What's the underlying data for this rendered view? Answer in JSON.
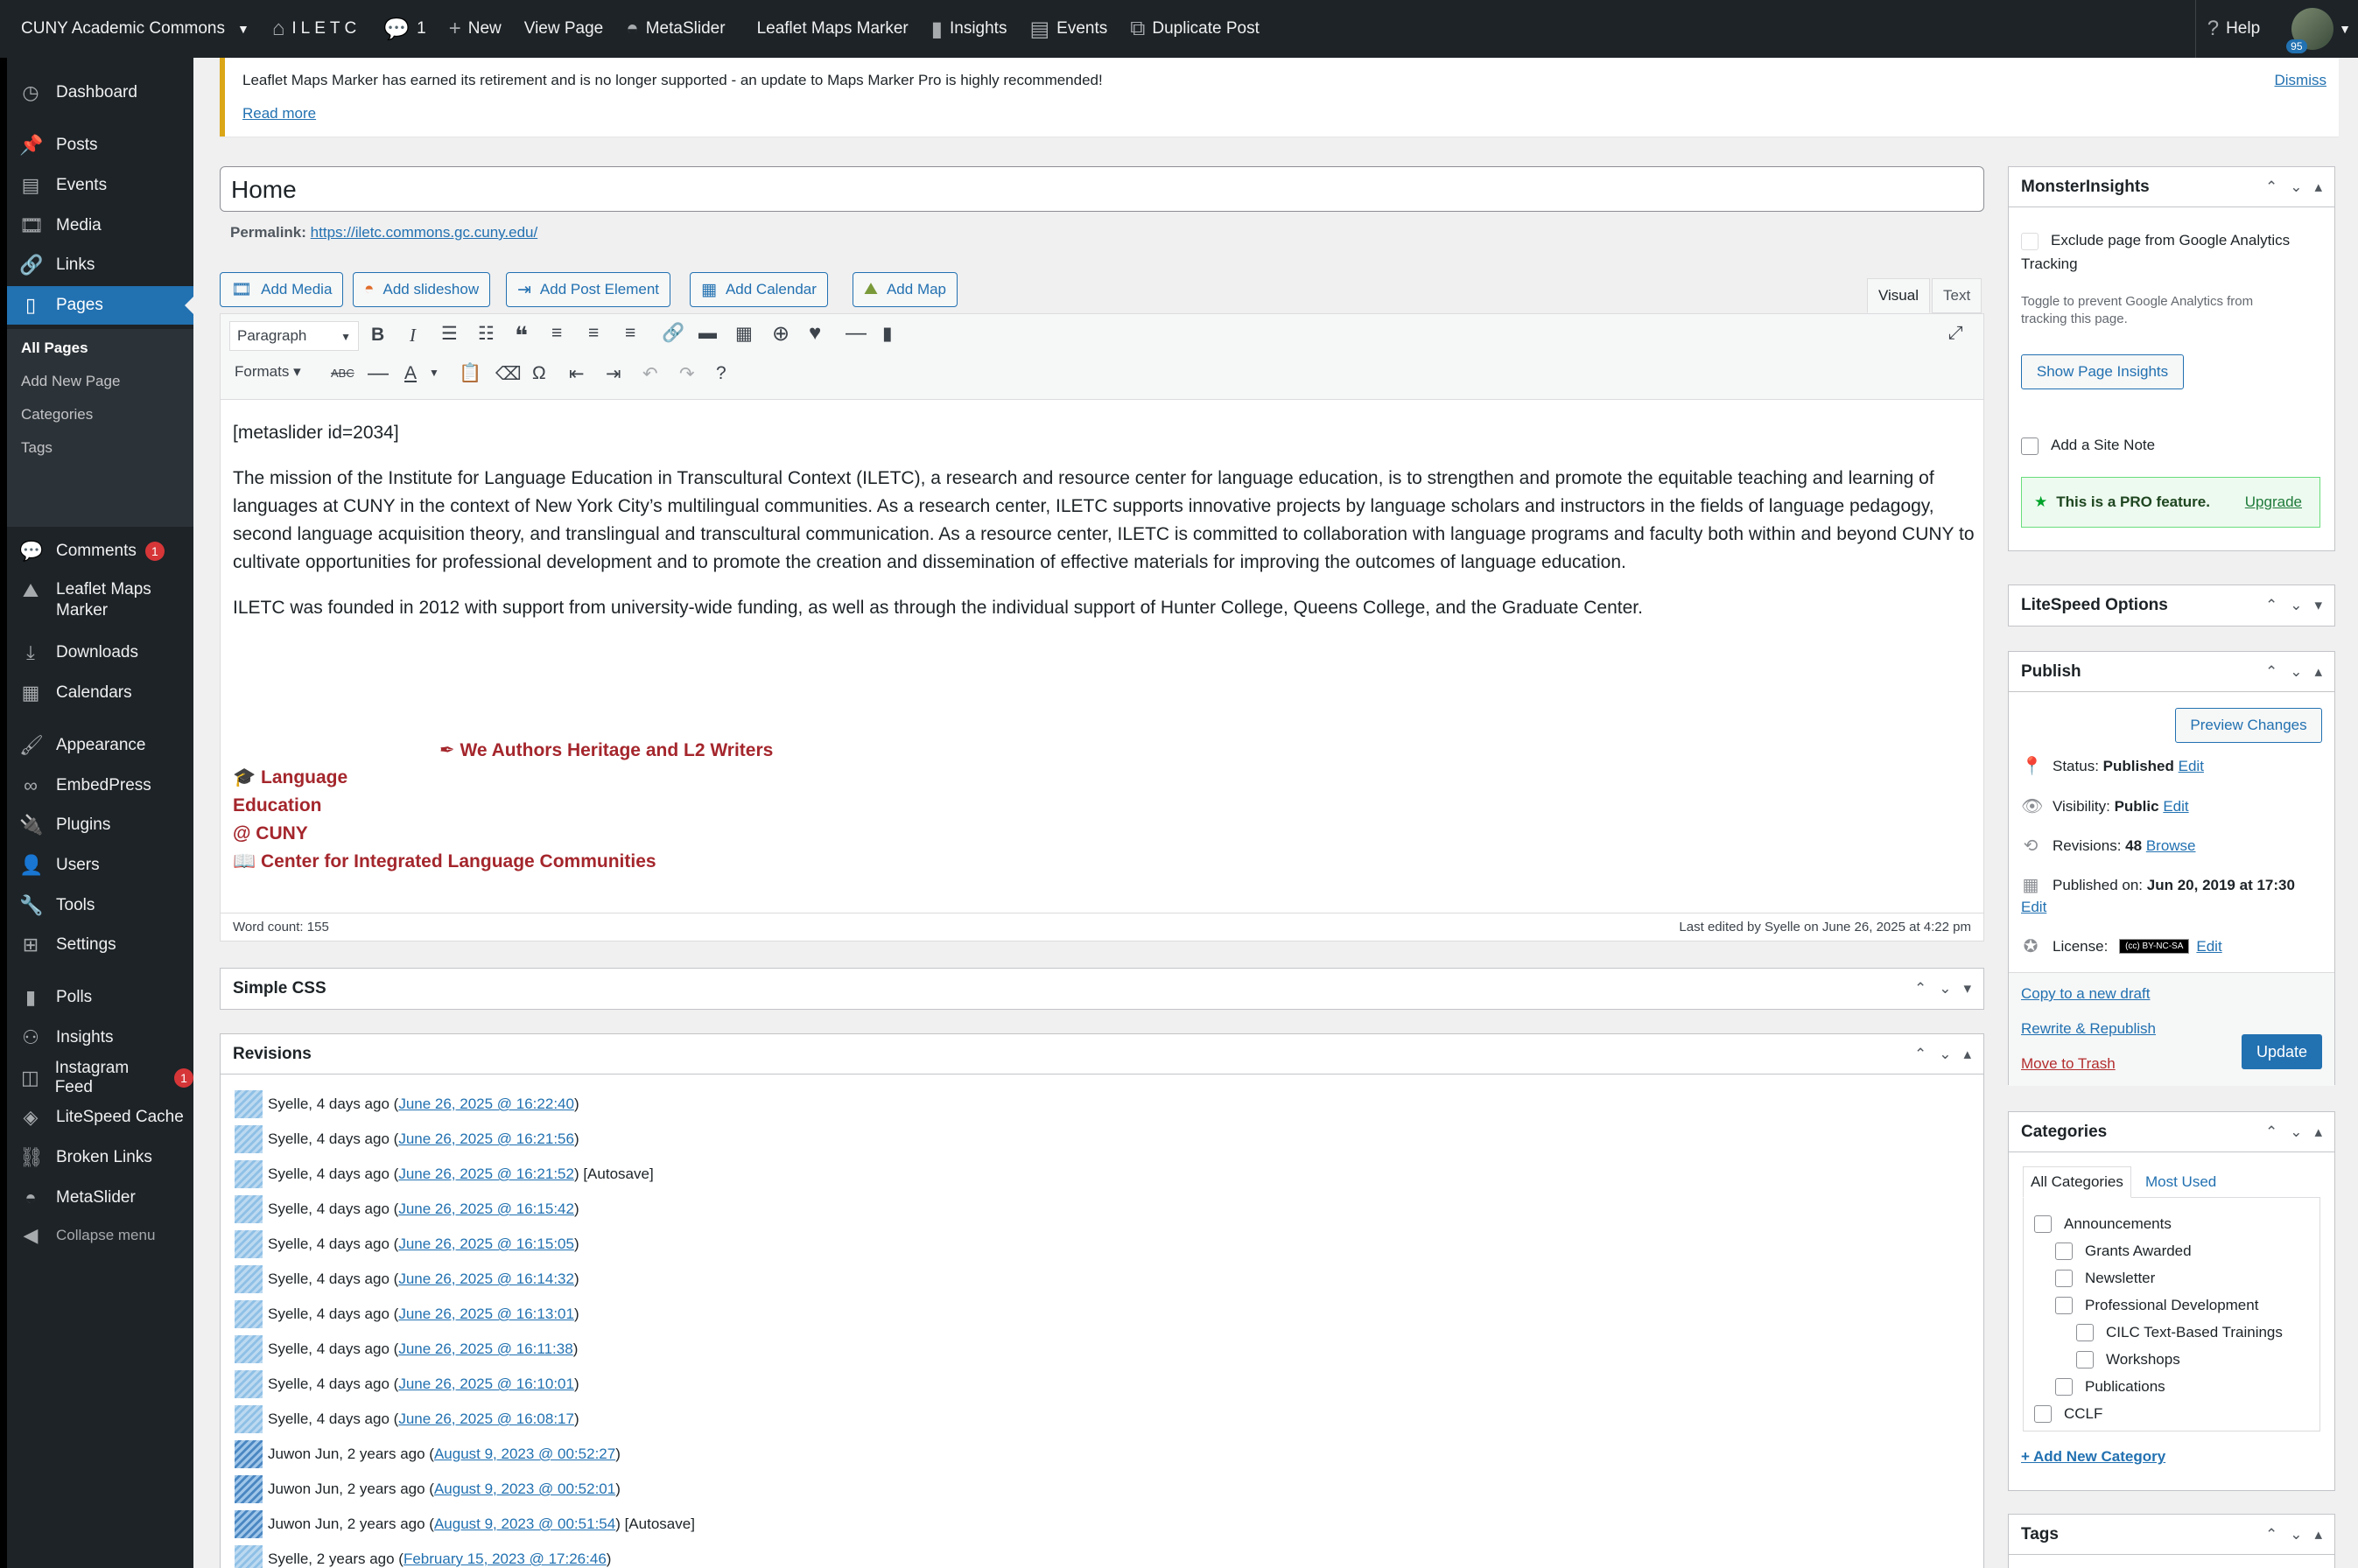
{
  "adminbar": {
    "site_name": "CUNY Academic Commons",
    "site": "ILETC",
    "comments_count": "1",
    "new": "New",
    "view_page": "View Page",
    "metaslider": "MetaSlider",
    "leaflet": "Leaflet Maps Marker",
    "insights": "Insights",
    "events": "Events",
    "duplicate": "Duplicate Post",
    "help": "Help",
    "avatar_badge": "95"
  },
  "sidebar": {
    "items": [
      {
        "label": "Dashboard",
        "icon": "dashboard-icon"
      },
      {
        "label": "Posts",
        "icon": "pin-icon"
      },
      {
        "label": "Events",
        "icon": "calendar-icon"
      },
      {
        "label": "Media",
        "icon": "media-icon"
      },
      {
        "label": "Links",
        "icon": "link-icon"
      },
      {
        "label": "Pages",
        "icon": "pages-icon"
      },
      {
        "label": "Comments",
        "icon": "comment-icon",
        "badge": "1"
      },
      {
        "label": "Leaflet Maps Marker",
        "icon": "map-icon"
      },
      {
        "label": "Downloads",
        "icon": "download-icon"
      },
      {
        "label": "Calendars",
        "icon": "calendar-31-icon"
      },
      {
        "label": "Appearance",
        "icon": "brush-icon"
      },
      {
        "label": "EmbedPress",
        "icon": "embed-icon"
      },
      {
        "label": "Plugins",
        "icon": "plug-icon"
      },
      {
        "label": "Users",
        "icon": "user-icon"
      },
      {
        "label": "Tools",
        "icon": "wrench-icon"
      },
      {
        "label": "Settings",
        "icon": "settings-icon"
      },
      {
        "label": "Polls",
        "icon": "chart-icon"
      },
      {
        "label": "Insights",
        "icon": "insights-icon"
      },
      {
        "label": "Instagram Feed",
        "icon": "instagram-icon",
        "badge": "1"
      },
      {
        "label": "LiteSpeed Cache",
        "icon": "diamond-icon"
      },
      {
        "label": "Broken Links",
        "icon": "broken-link-icon"
      },
      {
        "label": "MetaSlider",
        "icon": "metaslider-icon"
      },
      {
        "label": "Collapse menu",
        "icon": "collapse-icon"
      }
    ],
    "submenu": [
      "All Pages",
      "Add New Page",
      "Categories",
      "Tags"
    ]
  },
  "notice": {
    "text": "Leaflet Maps Marker has earned its retirement and is no longer supported - an update to Maps Marker Pro is highly recommended!",
    "read_more": "Read more",
    "dismiss": "Dismiss"
  },
  "editor": {
    "title": "Home",
    "permalink_label": "Permalink:",
    "permalink_url": "https://iletc.commons.gc.cuny.edu/",
    "media_buttons": [
      "Add Media",
      "Add slideshow",
      "Add Post Element",
      "Add Calendar",
      "Add Map"
    ],
    "tab_visual": "Visual",
    "tab_text": "Text",
    "paragraph": "Paragraph",
    "formats": "Formats",
    "shortcode": "[metaslider id=2034]",
    "para1": "The mission of the Institute for Language Education in Transcultural Context (ILETC), a research and resource center for language education, is to strengthen and promote the equitable teaching and learning of languages at CUNY in the context of New York City’s multilingual communities. As a research center, ILETC supports innovative projects by language scholars and instructors in the fields of language pedagogy, second language acquisition theory, and translingual and transcultural communication. As a resource center, ILETC is committed to collaboration with language programs and faculty both within and beyond CUNY to cultivate opportunities for professional development and to promote the creation and dissemination of effective materials for improving the outcomes of language education.",
    "para2": "ILETC was founded in 2012 with support from university-wide funding, as well as through the individual support of Hunter College, Queens College, and the Graduate Center.",
    "link_we_authors": "We Authors Heritage and L2 Writers",
    "link_lang_1": "Language",
    "link_lang_2": "Education",
    "link_lang_3": "@ CUNY",
    "link_center": "Center for Integrated Language Communities",
    "word_count": "Word count: 155",
    "last_edited": "Last edited by Syelle on June 26, 2025 at 4:22 pm"
  },
  "simple_css": {
    "title": "Simple CSS"
  },
  "revisions": {
    "title": "Revisions",
    "rows": [
      {
        "author": "Syelle, 4 days ago (",
        "link": "June 26, 2025 @ 16:22:40",
        "suffix": ")",
        "av": "s"
      },
      {
        "author": "Syelle, 4 days ago (",
        "link": "June 26, 2025 @ 16:21:56",
        "suffix": ")",
        "av": "s"
      },
      {
        "author": "Syelle, 4 days ago (",
        "link": "June 26, 2025 @ 16:21:52",
        "suffix": ") [Autosave]",
        "av": "s"
      },
      {
        "author": "Syelle, 4 days ago (",
        "link": "June 26, 2025 @ 16:15:42",
        "suffix": ")",
        "av": "s"
      },
      {
        "author": "Syelle, 4 days ago (",
        "link": "June 26, 2025 @ 16:15:05",
        "suffix": ")",
        "av": "s"
      },
      {
        "author": "Syelle, 4 days ago (",
        "link": "June 26, 2025 @ 16:14:32",
        "suffix": ")",
        "av": "s"
      },
      {
        "author": "Syelle, 4 days ago (",
        "link": "June 26, 2025 @ 16:13:01",
        "suffix": ")",
        "av": "s"
      },
      {
        "author": "Syelle, 4 days ago (",
        "link": "June 26, 2025 @ 16:11:38",
        "suffix": ")",
        "av": "s"
      },
      {
        "author": "Syelle, 4 days ago (",
        "link": "June 26, 2025 @ 16:10:01",
        "suffix": ")",
        "av": "s"
      },
      {
        "author": "Syelle, 4 days ago (",
        "link": "June 26, 2025 @ 16:08:17",
        "suffix": ")",
        "av": "s"
      },
      {
        "author": "Juwon Jun, 2 years ago (",
        "link": "August 9, 2023 @ 00:52:27",
        "suffix": ")",
        "av": "j"
      },
      {
        "author": "Juwon Jun, 2 years ago (",
        "link": "August 9, 2023 @ 00:52:01",
        "suffix": ")",
        "av": "j"
      },
      {
        "author": "Juwon Jun, 2 years ago (",
        "link": "August 9, 2023 @ 00:51:54",
        "suffix": ") [Autosave]",
        "av": "j"
      },
      {
        "author": "Syelle, 2 years ago (",
        "link": "February 15, 2023 @ 17:26:46",
        "suffix": ")",
        "av": "s"
      }
    ]
  },
  "monsterinsights": {
    "title": "MonsterInsights",
    "exclude_1": "Exclude page from Google Analytics",
    "exclude_2": "Tracking",
    "help_1": "Toggle to prevent Google Analytics from",
    "help_2": "tracking this page.",
    "show_insights": "Show Page Insights",
    "site_note": "Add a Site Note",
    "pro": "This is a PRO feature.",
    "upgrade": "Upgrade"
  },
  "litespeed": {
    "title": "LiteSpeed Options"
  },
  "publish": {
    "title": "Publish",
    "preview": "Preview Changes",
    "status_label": "Status:",
    "status": "Published",
    "visibility_label": "Visibility:",
    "visibility": "Public",
    "revisions_label": "Revisions:",
    "revisions": "48",
    "browse": "Browse",
    "published_label": "Published on:",
    "published": "Jun 20, 2019 at 17:30",
    "license_label": "License:",
    "license_badge": "BY-NC-SA",
    "edit": "Edit",
    "copy_draft": "Copy to a new draft",
    "rewrite": "Rewrite & Republish",
    "trash": "Move to Trash",
    "update": "Update"
  },
  "categories": {
    "title": "Categories",
    "tab_all": "All Categories",
    "tab_used": "Most Used",
    "items": [
      {
        "label": "Announcements",
        "level": 0
      },
      {
        "label": "Grants Awarded",
        "level": 1
      },
      {
        "label": "Newsletter",
        "level": 1
      },
      {
        "label": "Professional Development",
        "level": 1
      },
      {
        "label": "CILC Text-Based Trainings",
        "level": 2
      },
      {
        "label": "Workshops",
        "level": 2
      },
      {
        "label": "Publications",
        "level": 1
      },
      {
        "label": "CCLF",
        "level": 0
      }
    ],
    "add_new": "+ Add New Category"
  },
  "tags": {
    "title": "Tags"
  }
}
